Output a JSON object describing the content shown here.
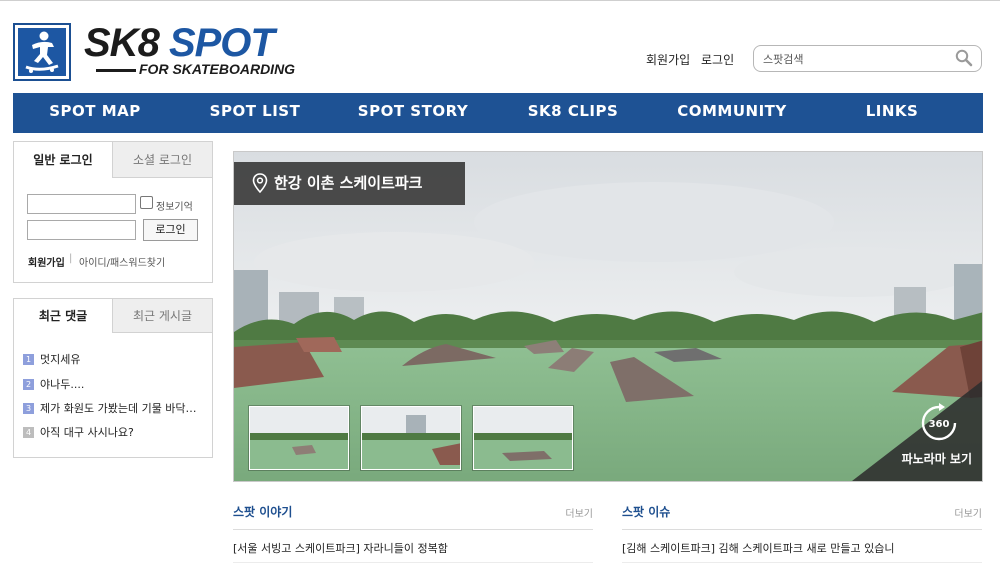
{
  "header": {
    "logo": {
      "main": "SK8 SPOT",
      "main_a": "SK8",
      "main_b": "SPOT",
      "sub": "FOR SKATEBOARDING"
    },
    "links": {
      "signup": "회원가입",
      "login": "로그인"
    },
    "search": {
      "placeholder": "스팟검색",
      "icon": "search-icon"
    }
  },
  "nav": {
    "items": [
      "SPOT MAP",
      "SPOT LIST",
      "SPOT STORY",
      "SK8 CLIPS",
      "COMMUNITY",
      "LINKS"
    ]
  },
  "login_box": {
    "tabs": [
      "일반 로그인",
      "소셜 로그인"
    ],
    "remember_label": "정보기억",
    "login_button": "로그인",
    "signup_link": "회원가입",
    "divider": "|",
    "find_link": "아이디/패스워드찾기"
  },
  "recent_box": {
    "tabs": [
      "최근 댓글",
      "최근 게시글"
    ],
    "items": [
      {
        "num": "1",
        "text": "멋지세유"
      },
      {
        "num": "2",
        "text": "야나두...."
      },
      {
        "num": "3",
        "text": "제가 화원도 가봤는데 기물 바닥…"
      },
      {
        "num": "4",
        "text": "아직 대구 사시나요?"
      }
    ],
    "num_colors": {
      "active": "#8e9fdc",
      "inactive": "#bdbdbd"
    }
  },
  "hero": {
    "title": "한강 이촌 스케이트파크",
    "panorama_badge": "360",
    "panorama_label": "파노라마 보기",
    "thumbnail_count": 3
  },
  "story": {
    "title": "스팟 이야기",
    "more": "더보기",
    "items": [
      "[서울 서빙고 스케이트파크]  자라니들이 정복함"
    ]
  },
  "issue": {
    "title": "스팟 이슈",
    "more": "더보기",
    "items": [
      "[김해 스케이트파크]  김해 스케이트파크 새로 만들고 있습니"
    ]
  },
  "colors": {
    "brand": "#1e5294",
    "accent": "#1d57a3"
  }
}
